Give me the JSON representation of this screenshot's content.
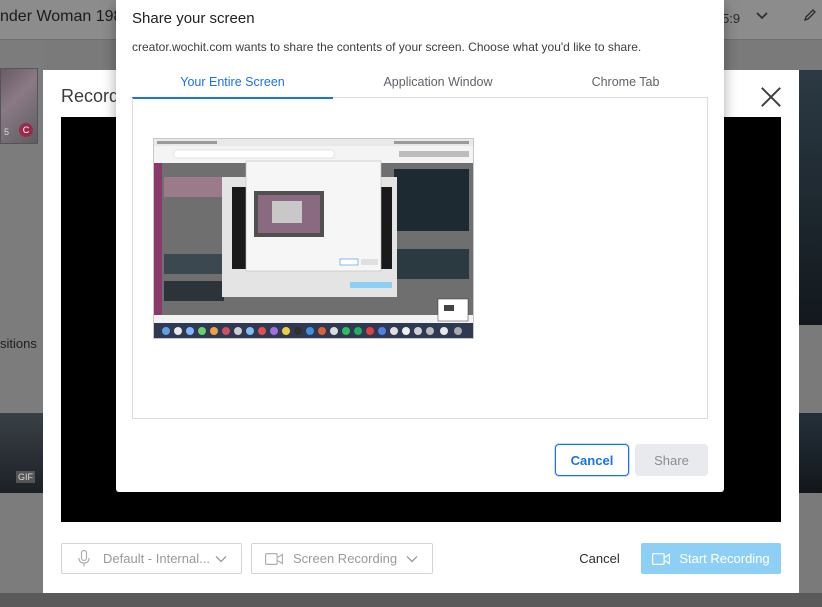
{
  "background": {
    "title": "nder Woman 198",
    "aspect_ratio": "5:9",
    "positions_label": "sitions",
    "thumb_number": "5",
    "thumb_badge": "C",
    "film_badge": "GIF"
  },
  "recording_modal": {
    "title": "Record",
    "audio_select": "Default - Internal...",
    "video_select": "Screen Recording",
    "cancel_label": "Cancel",
    "start_label": "Start Recording",
    "start_color": "#8ecff5"
  },
  "share_dialog": {
    "title": "Share your screen",
    "description": "creator.wochit.com wants to share the contents of your screen. Choose what you'd like to share.",
    "tabs": [
      {
        "label": "Your Entire Screen",
        "active": true
      },
      {
        "label": "Application Window",
        "active": false
      },
      {
        "label": "Chrome Tab",
        "active": false
      }
    ],
    "cancel_label": "Cancel",
    "share_label": "Share",
    "accent_color": "#1a73e8"
  }
}
